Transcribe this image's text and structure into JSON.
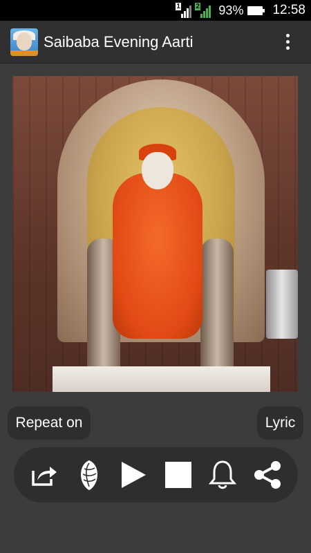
{
  "status_bar": {
    "sim1": "1",
    "sim2": "2",
    "battery": "93%",
    "time": "12:58"
  },
  "app_bar": {
    "title": "Saibaba Evening Aarti",
    "logo_icon": "saibaba-app-icon",
    "overflow_icon": "more-vert-icon"
  },
  "buttons": {
    "repeat_label": "Repeat on",
    "lyric_label": "Lyric"
  },
  "controls": [
    {
      "name": "open-share-icon"
    },
    {
      "name": "conch-shell-icon"
    },
    {
      "name": "play-icon"
    },
    {
      "name": "stop-icon"
    },
    {
      "name": "bell-icon"
    },
    {
      "name": "share-icon"
    }
  ],
  "colors": {
    "background": "#3c3c3c",
    "app_bar": "#303030",
    "button_bg": "#2e2e2e",
    "status_bar": "#000000"
  }
}
